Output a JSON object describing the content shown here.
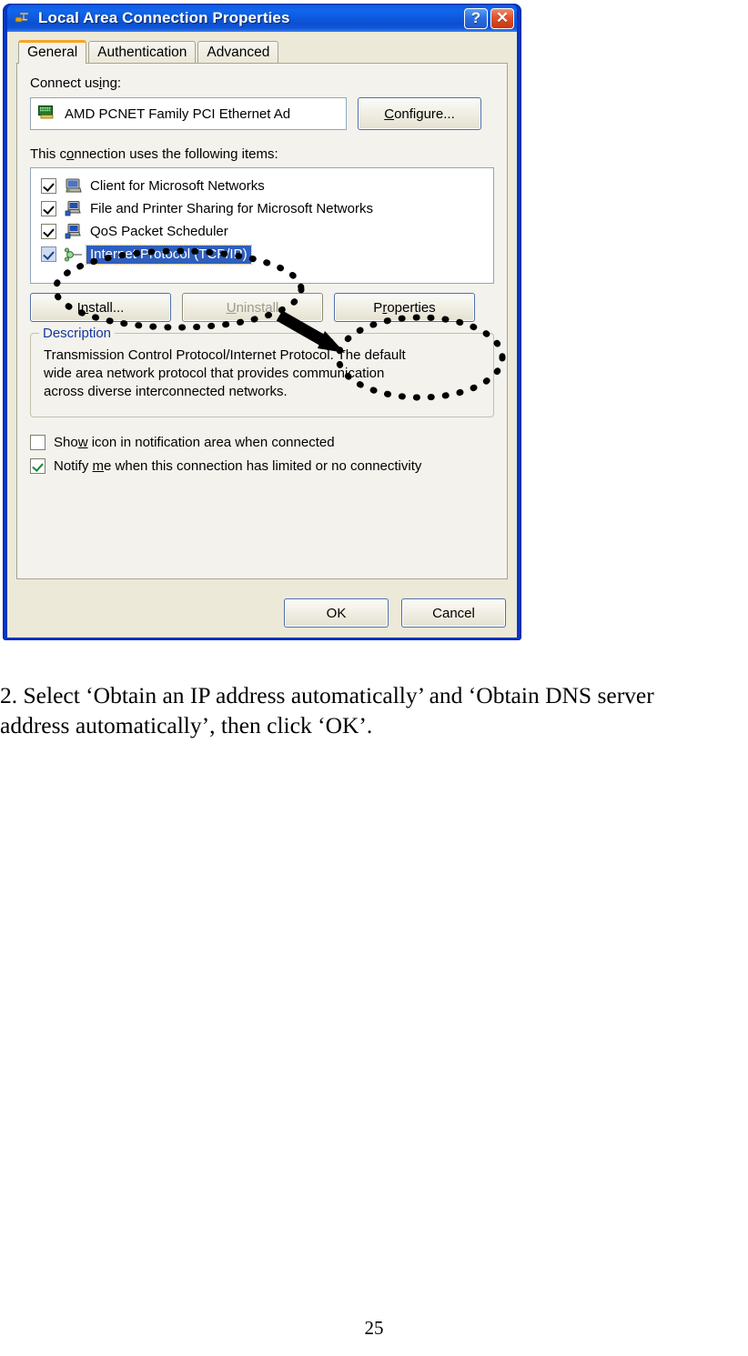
{
  "dialog": {
    "title": "Local Area Connection Properties",
    "window_icon": "network-connection-icon",
    "help_button": "?",
    "close_button": "✕",
    "tabs": [
      {
        "label": "General",
        "active": true
      },
      {
        "label": "Authentication",
        "active": false
      },
      {
        "label": "Advanced",
        "active": false
      }
    ],
    "connect_using": {
      "label": "Connect using:",
      "adapter": "AMD PCNET Family PCI Ethernet Ad",
      "adapter_icon": "network-adapter-icon",
      "configure_button": "Configure..."
    },
    "items_section": {
      "label": "This connection uses the following items:",
      "items": [
        {
          "label": "Client for Microsoft Networks",
          "checked": true,
          "selected": false,
          "icon": "client-computer-icon"
        },
        {
          "label": "File and Printer Sharing for Microsoft Networks",
          "checked": true,
          "selected": false,
          "icon": "file-sharing-computer-icon"
        },
        {
          "label": "QoS Packet Scheduler",
          "checked": true,
          "selected": false,
          "icon": "qos-computer-icon"
        },
        {
          "label": "Internet Protocol (TCP/IP)",
          "checked": true,
          "selected": true,
          "icon": "protocol-node-icon"
        }
      ]
    },
    "buttons": {
      "install": "Install...",
      "uninstall": "Uninstall",
      "properties": "Properties",
      "uninstall_disabled": true
    },
    "description": {
      "legend": "Description",
      "lines": [
        "Transmission Control Protocol/Internet Protocol. The default",
        "wide area network protocol that provides communication",
        "across diverse interconnected networks."
      ]
    },
    "options": [
      {
        "label": "Show icon in notification area when connected",
        "checked": false
      },
      {
        "label": "Notify me when this connection has limited or no connectivity",
        "checked": true
      }
    ],
    "footer": {
      "ok": "OK",
      "cancel": "Cancel"
    },
    "colors": {
      "titlebar_blue": "#0e5fe4",
      "dialog_face": "#ece9d8",
      "tab_panel": "#f3f2ec",
      "selection_blue": "#2f5fbd",
      "active_tab_accent": "#f5a623",
      "legend_blue": "#16379e",
      "close_red": "#e2512a"
    }
  },
  "annotations": {
    "ellipse_tcpip": "highlight-ellipse-around-internet-protocol",
    "ellipse_properties": "highlight-ellipse-around-properties-button",
    "arrow": "arrow-from-protocol-to-properties"
  },
  "body_text": {
    "line1": "2. Select ‘Obtain an IP address automatically’ and ‘Obtain DNS server",
    "line2": "address automatically’, then click ‘OK’."
  },
  "page_number": "25"
}
